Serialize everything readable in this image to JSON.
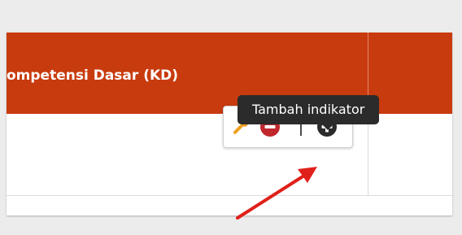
{
  "table": {
    "header_label": "ompetensi Dasar (KD)"
  },
  "actions": {
    "edit_icon": "wrench-icon",
    "remove_icon": "minus-circle-icon",
    "add_icon": "plus-circle-icon"
  },
  "tooltip": {
    "text": "Tambah indikator"
  },
  "colors": {
    "header_bg": "#c83b0e",
    "wrench": "#f0a020",
    "remove": "#c0272d",
    "add": "#2b2b2b",
    "annotation_arrow": "#e0201a"
  }
}
